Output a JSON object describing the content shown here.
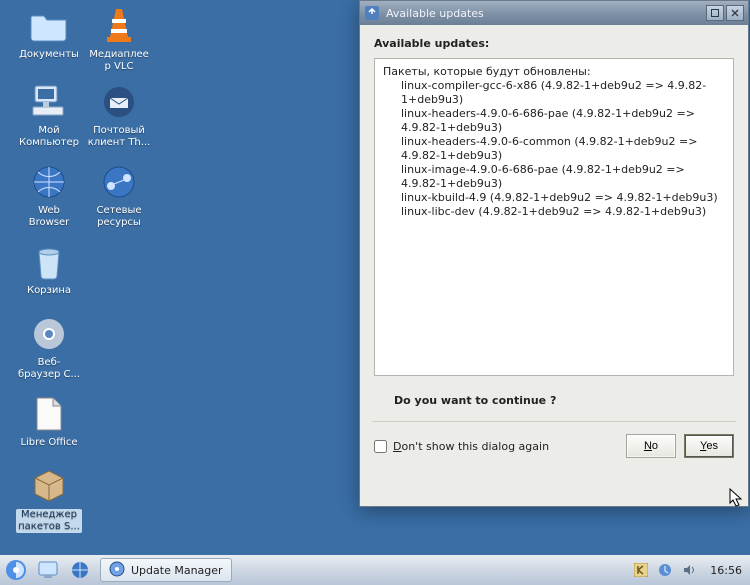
{
  "desktop": {
    "icons": [
      {
        "id": "documents",
        "label": "Документы"
      },
      {
        "id": "vlc",
        "label": "Медиаплее\nр VLC"
      },
      {
        "id": "mycomputer",
        "label": "Мой\nКомпьютер"
      },
      {
        "id": "thunderbird",
        "label": "Почтовый\nклиент Th..."
      },
      {
        "id": "webbrowser",
        "label": "Web\nBrowser"
      },
      {
        "id": "network",
        "label": "Сетевые\nресурсы"
      },
      {
        "id": "trash",
        "label": "Корзина"
      },
      {
        "id": "chromium",
        "label": "Веб-\nбраузер С..."
      },
      {
        "id": "libreoffice",
        "label": "Libre Office"
      },
      {
        "id": "pkgmanager",
        "label": "Менеджер\nпакетов S..."
      }
    ]
  },
  "taskbar": {
    "active_task": "Update Manager",
    "clock": "16:56"
  },
  "dialog": {
    "title": "Available updates",
    "heading": "Available updates:",
    "list_header": "Пакеты, которые будут обновлены:",
    "packages": [
      "linux-compiler-gcc-6-x86 (4.9.82-1+deb9u2 => 4.9.82-1+deb9u3)",
      "linux-headers-4.9.0-6-686-pae (4.9.82-1+deb9u2 => 4.9.82-1+deb9u3)",
      "linux-headers-4.9.0-6-common (4.9.82-1+deb9u2 => 4.9.82-1+deb9u3)",
      "linux-image-4.9.0-6-686-pae (4.9.82-1+deb9u2 => 4.9.82-1+deb9u3)",
      "linux-kbuild-4.9 (4.9.82-1+deb9u2 => 4.9.82-1+deb9u3)",
      "linux-libc-dev (4.9.82-1+deb9u2 => 4.9.82-1+deb9u3)"
    ],
    "question": "Do you want to continue ?",
    "dont_show_letter": "D",
    "dont_show_rest": "on't show this dialog again",
    "no_letter": "N",
    "no_rest": "o",
    "yes_letter": "Y",
    "yes_rest": "es"
  }
}
